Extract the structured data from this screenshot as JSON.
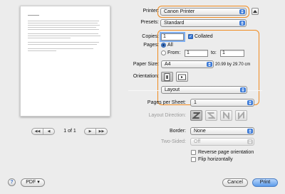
{
  "printer": {
    "label": "Printer:",
    "value": "Canon Printer"
  },
  "presets": {
    "label": "Presets:",
    "value": "Standard"
  },
  "copies": {
    "label": "Copies:",
    "value": "1",
    "collated_label": "Collated",
    "collated": true
  },
  "pages": {
    "label": "Pages:",
    "all_label": "All",
    "from_label": "From:",
    "from_value": "1",
    "to_label": "to:",
    "to_value": "1",
    "selected": "All"
  },
  "paper_size": {
    "label": "Paper Size:",
    "value": "A4",
    "dimensions": "20.99 by 29.70 cm"
  },
  "orientation": {
    "label": "Orientation:",
    "selected": "portrait"
  },
  "section_popup": {
    "value": "Layout"
  },
  "layout": {
    "pages_per_sheet_label": "Pages per Sheet:",
    "pages_per_sheet_value": "1",
    "direction_label": "Layout Direction:",
    "border_label": "Border:",
    "border_value": "None",
    "two_sided_label": "Two-Sided:",
    "two_sided_value": "Off",
    "reverse_label": "Reverse page orientation",
    "flip_label": "Flip horizontally"
  },
  "preview": {
    "page_indicator": "1 of 1"
  },
  "pager": {
    "first": "◀◀",
    "prev": "◀",
    "next": "▶",
    "last": "▶▶"
  },
  "footer": {
    "help": "?",
    "pdf_label": "PDF ▾",
    "cancel_label": "Cancel",
    "print_label": "Print"
  },
  "colors": {
    "highlight": "#f08a1e",
    "accent": "#3d7bd8"
  },
  "icons": [
    "help-icon",
    "collapse-details-icon",
    "portrait-icon",
    "landscape-icon",
    "direction-z-icon",
    "direction-s-icon",
    "direction-n-icon",
    "direction-reverse-n-icon"
  ]
}
